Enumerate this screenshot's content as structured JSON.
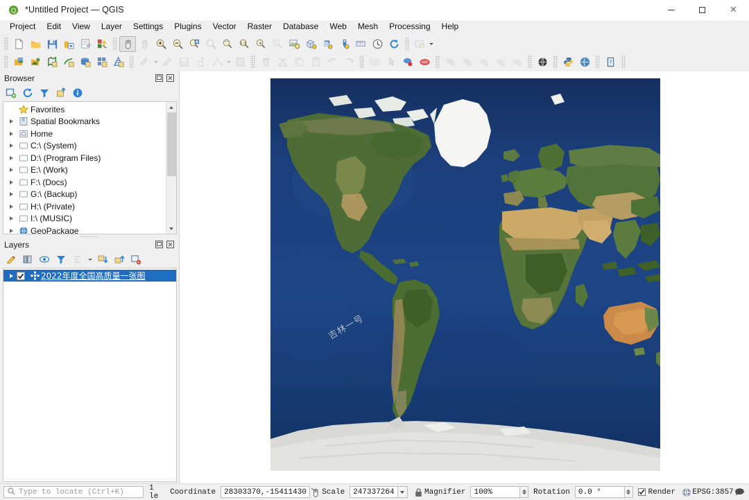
{
  "window": {
    "title": "*Untitled Project — QGIS",
    "app_icon": "qgis-logo-icon",
    "minimize_label": "Minimize",
    "maximize_label": "Maximize",
    "close_label": "Close"
  },
  "menubar": {
    "items": [
      {
        "label": "Project",
        "accel": ""
      },
      {
        "label": "Edit",
        "accel": "E"
      },
      {
        "label": "View",
        "accel": "V"
      },
      {
        "label": "Layer",
        "accel": "L"
      },
      {
        "label": "Settings",
        "accel": "S"
      },
      {
        "label": "Plugins",
        "accel": "P"
      },
      {
        "label": "Vector",
        "accel": "o"
      },
      {
        "label": "Raster",
        "accel": "R"
      },
      {
        "label": "Database",
        "accel": "D"
      },
      {
        "label": "Web",
        "accel": "W"
      },
      {
        "label": "Mesh",
        "accel": "M"
      },
      {
        "label": "Processing",
        "accel": ""
      },
      {
        "label": "Help",
        "accel": "H"
      }
    ]
  },
  "toolbar_row1": [
    {
      "name": "new-project-button",
      "tip": "New Project"
    },
    {
      "name": "open-project-button",
      "tip": "Open Project"
    },
    {
      "name": "save-project-button",
      "tip": "Save Project"
    },
    {
      "name": "save-project-as-button",
      "tip": "Save Project As"
    },
    {
      "name": "new-print-layout-button",
      "tip": "New Print Layout"
    },
    {
      "name": "style-manager-button",
      "tip": "Style Manager"
    },
    {
      "name": "pan-map-button",
      "tip": "Pan Map"
    },
    {
      "name": "pan-to-selection-button",
      "tip": "Pan Map to Selection"
    },
    {
      "name": "zoom-in-button",
      "tip": "Zoom In"
    },
    {
      "name": "zoom-out-button",
      "tip": "Zoom Out"
    },
    {
      "name": "zoom-full-button",
      "tip": "Zoom Full"
    },
    {
      "name": "zoom-selection-button",
      "tip": "Zoom To Selection"
    },
    {
      "name": "zoom-layer-button",
      "tip": "Zoom To Layer"
    },
    {
      "name": "zoom-native-button",
      "tip": "Zoom To Native Resolution"
    },
    {
      "name": "zoom-last-button",
      "tip": "Zoom Last"
    },
    {
      "name": "zoom-next-button",
      "tip": "Zoom Next"
    },
    {
      "name": "new-map-view-button",
      "tip": "New Map View"
    },
    {
      "name": "new-3d-map-view-button",
      "tip": "New 3D Map View"
    },
    {
      "name": "refresh-button",
      "tip": "Refresh"
    },
    {
      "name": "identify-features-button",
      "tip": "Identify Features"
    },
    {
      "name": "measure-button",
      "tip": "Measure"
    },
    {
      "name": "temporal-controller-button",
      "tip": "Temporal Controller Panel"
    },
    {
      "name": "reload-button",
      "tip": "Reload"
    },
    {
      "name": "show-map-tips-button",
      "tip": "Show Map Tips"
    }
  ],
  "toolbar_row2": [
    {
      "name": "data-source-manager-button",
      "tip": "Open Data Source Manager"
    },
    {
      "name": "add-vector-layer-button",
      "tip": "Add Vector Layer"
    },
    {
      "name": "add-raster-layer-button",
      "tip": "Add Raster Layer"
    },
    {
      "name": "add-delimited-text-layer-button",
      "tip": "Add Delimited Text Layer"
    },
    {
      "name": "add-postgis-layer-button",
      "tip": "Add PostGIS Layers"
    },
    {
      "name": "add-spatialite-layer-button",
      "tip": "Add SpatiaLite Layer"
    },
    {
      "name": "add-mesh-layer-button",
      "tip": "Add Mesh Layer"
    },
    {
      "name": "current-edits-button",
      "tip": "Current Edits"
    },
    {
      "name": "toggle-editing-button",
      "tip": "Toggle Editing"
    },
    {
      "name": "save-layer-edits-button",
      "tip": "Save Layer Edits"
    },
    {
      "name": "add-feature-button",
      "tip": "Add Feature"
    },
    {
      "name": "vertex-tool-button",
      "tip": "Vertex Tool"
    },
    {
      "name": "modify-attributes-button",
      "tip": "Modify Attributes of Features"
    },
    {
      "name": "delete-selected-button",
      "tip": "Delete Selected"
    },
    {
      "name": "cut-features-button",
      "tip": "Cut Features"
    },
    {
      "name": "copy-features-button",
      "tip": "Copy Features"
    },
    {
      "name": "paste-features-button",
      "tip": "Paste Features"
    },
    {
      "name": "undo-button",
      "tip": "Undo"
    },
    {
      "name": "redo-button",
      "tip": "Redo"
    },
    {
      "name": "open-attribute-table-button",
      "tip": "Open Attribute Table"
    },
    {
      "name": "select-features-button",
      "tip": "Select Features"
    },
    {
      "name": "deselect-features-button",
      "tip": "Deselect Features"
    },
    {
      "name": "select-by-expression-button",
      "tip": "Select By Expression"
    },
    {
      "name": "new-shapefile-layer-button",
      "tip": "New Shapefile Layer"
    },
    {
      "name": "new-geopackage-layer-button",
      "tip": "New GeoPackage Layer"
    },
    {
      "name": "new-spatialite-layer-button",
      "tip": "New SpatiaLite Layer"
    },
    {
      "name": "new-virtual-layer-button",
      "tip": "New Virtual Layer"
    },
    {
      "name": "new-memory-layer-button",
      "tip": "New Temporary Scratch Layer"
    },
    {
      "name": "metasearch-button",
      "tip": "MetaSearch"
    },
    {
      "name": "python-console-button",
      "tip": "Python Console"
    },
    {
      "name": "plugin-manager-button",
      "tip": "Plugins Manager"
    },
    {
      "name": "help-contents-button",
      "tip": "Help Contents"
    }
  ],
  "browser_panel": {
    "title": "Browser",
    "float_button_label": "Float",
    "close_button_label": "Close",
    "toolbar": [
      {
        "name": "add-layers-button",
        "tip": "Add Selected Layers"
      },
      {
        "name": "refresh-browser-button",
        "tip": "Refresh"
      },
      {
        "name": "filter-browser-button",
        "tip": "Filter Browser"
      },
      {
        "name": "collapse-all-button",
        "tip": "Collapse All"
      },
      {
        "name": "enable-properties-button",
        "tip": "Enable/disable properties widget"
      }
    ],
    "tree": [
      {
        "label": "Favorites",
        "icon": "star-icon",
        "expandable": false
      },
      {
        "label": "Spatial Bookmarks",
        "icon": "bookmark-icon",
        "expandable": true
      },
      {
        "label": "Home",
        "icon": "home-icon",
        "expandable": true
      },
      {
        "label": "C:\\ (System)",
        "icon": "folder-icon",
        "expandable": true
      },
      {
        "label": "D:\\ (Program Files)",
        "icon": "folder-icon",
        "expandable": true
      },
      {
        "label": "E:\\ (Work)",
        "icon": "folder-icon",
        "expandable": true
      },
      {
        "label": "F:\\ (Docs)",
        "icon": "folder-icon",
        "expandable": true
      },
      {
        "label": "G:\\ (Backup)",
        "icon": "folder-icon",
        "expandable": true
      },
      {
        "label": "H:\\ (Private)",
        "icon": "folder-icon",
        "expandable": true
      },
      {
        "label": "I:\\ (MUSIC)",
        "icon": "folder-icon",
        "expandable": true
      },
      {
        "label": "GeoPackage",
        "icon": "geopackage-icon",
        "expandable": true
      }
    ]
  },
  "layers_panel": {
    "title": "Layers",
    "float_button_label": "Float",
    "close_button_label": "Close",
    "toolbar": [
      {
        "name": "open-layer-styling-button",
        "tip": "Open the Layer Styling panel"
      },
      {
        "name": "add-group-button",
        "tip": "Add Group"
      },
      {
        "name": "manage-visibility-button",
        "tip": "Manage Map Themes"
      },
      {
        "name": "filter-legend-button",
        "tip": "Filter Legend"
      },
      {
        "name": "filter-legend-expression-button",
        "tip": "Filter Legend by Expression"
      },
      {
        "name": "expand-all-button",
        "tip": "Expand All"
      },
      {
        "name": "collapse-all-layers-button",
        "tip": "Collapse All"
      },
      {
        "name": "remove-layer-button",
        "tip": "Remove Layer/Group"
      }
    ],
    "layers": [
      {
        "name": "2022年度全国高质量一张图",
        "checked": true,
        "selected": true,
        "icon": "raster-layer-icon"
      }
    ]
  },
  "map": {
    "watermark": "吉林一号",
    "ocean_color": "#1b3a73",
    "land_green": "#4f7033",
    "land_tan": "#c9a96a",
    "ice_white": "#f2f2f0",
    "antarctica_color": "#d8d8d4"
  },
  "statusbar": {
    "locate_placeholder": "Type to locate (Ctrl+K)",
    "search_icon": "search-icon",
    "message": "1 le",
    "coordinate_label": "Coordinate",
    "coordinate_value": "28303370,-15411430",
    "toggle_extents_icon": "toggle-extents-icon",
    "scale_label": "Scale",
    "scale_value": "247337264",
    "lock_icon": "lock-icon",
    "magnifier_label": "Magnifier",
    "magnifier_value": "100%",
    "rotation_label": "Rotation",
    "rotation_value": "0.0 °",
    "render_label": "Render",
    "render_checked": true,
    "crs_icon": "globe-icon",
    "crs_label": "EPSG:3857",
    "messages_icon": "messages-icon"
  }
}
